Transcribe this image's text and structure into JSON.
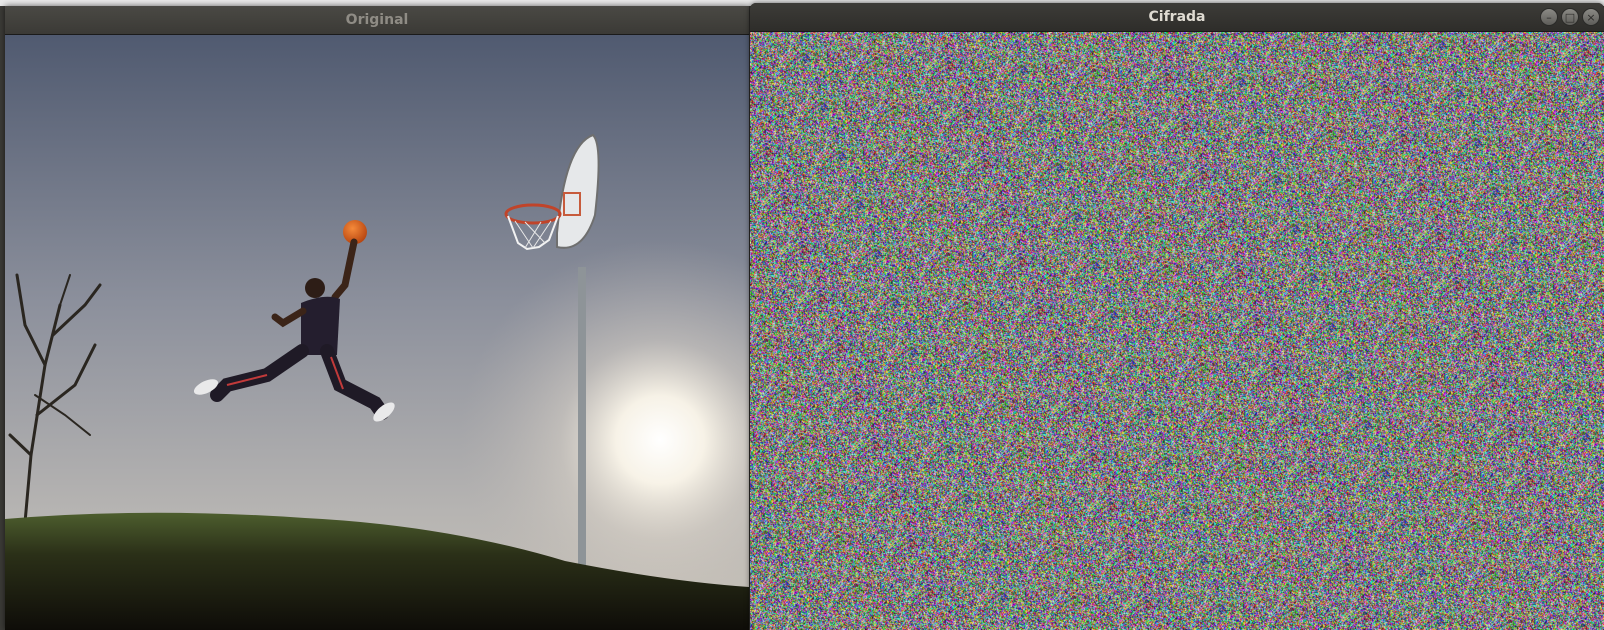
{
  "windows": {
    "original": {
      "title": "Original"
    },
    "cifrada": {
      "title": "Cifrada",
      "controls": {
        "minimize": "–",
        "maximize": "□",
        "close": "×"
      }
    }
  },
  "icons": {
    "minimize": "minimize-icon",
    "maximize": "maximize-icon",
    "close": "close-icon"
  },
  "colors": {
    "titlebar": "#3b3a36",
    "title_text_active": "#dfdbd2",
    "title_text_inactive": "#8f8c85",
    "noise_base": "#8b8d85"
  }
}
